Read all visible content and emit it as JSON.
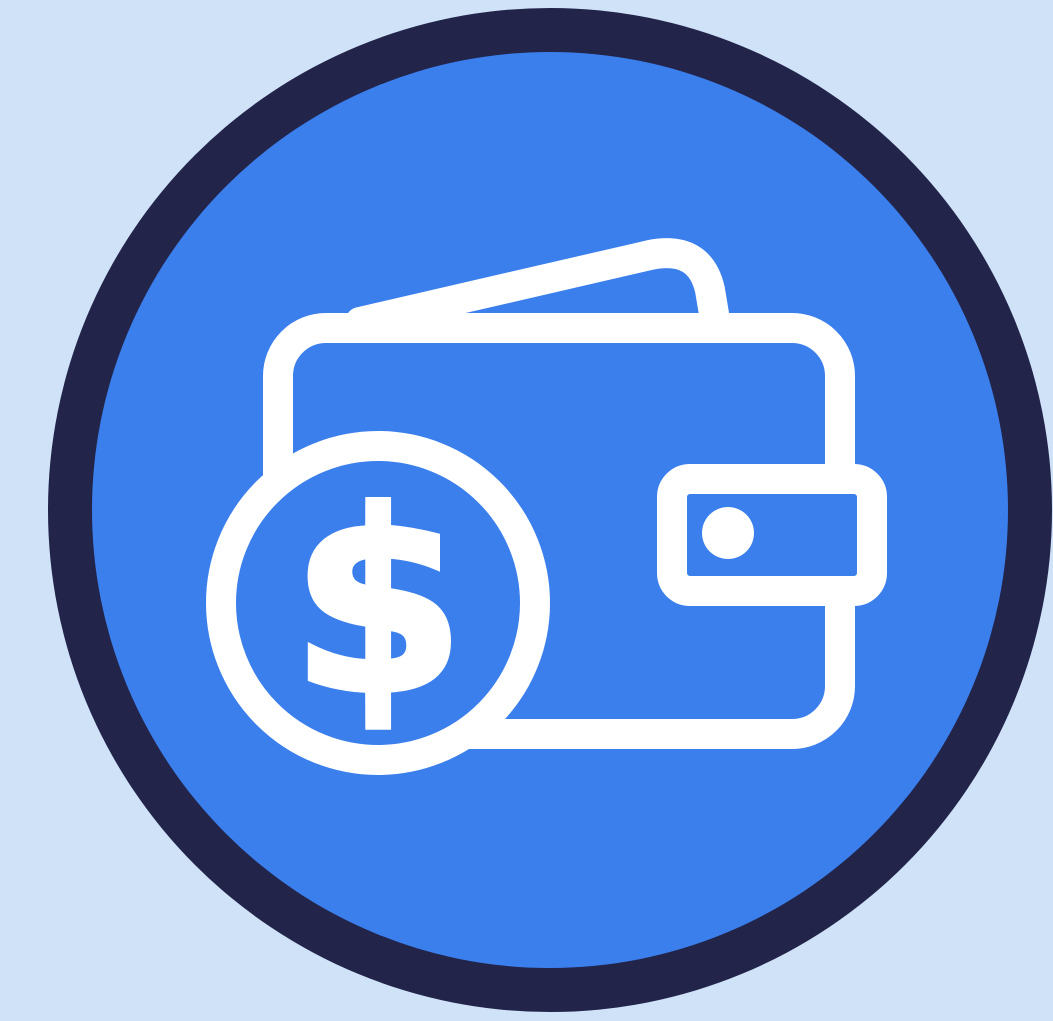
{
  "icon": {
    "name": "wallet-with-dollar-coin-icon",
    "symbol": "$"
  },
  "colors": {
    "background": "#cfe2f8",
    "ring": "#22244a",
    "badge_fill": "#3b7fed",
    "line": "#ffffff"
  }
}
